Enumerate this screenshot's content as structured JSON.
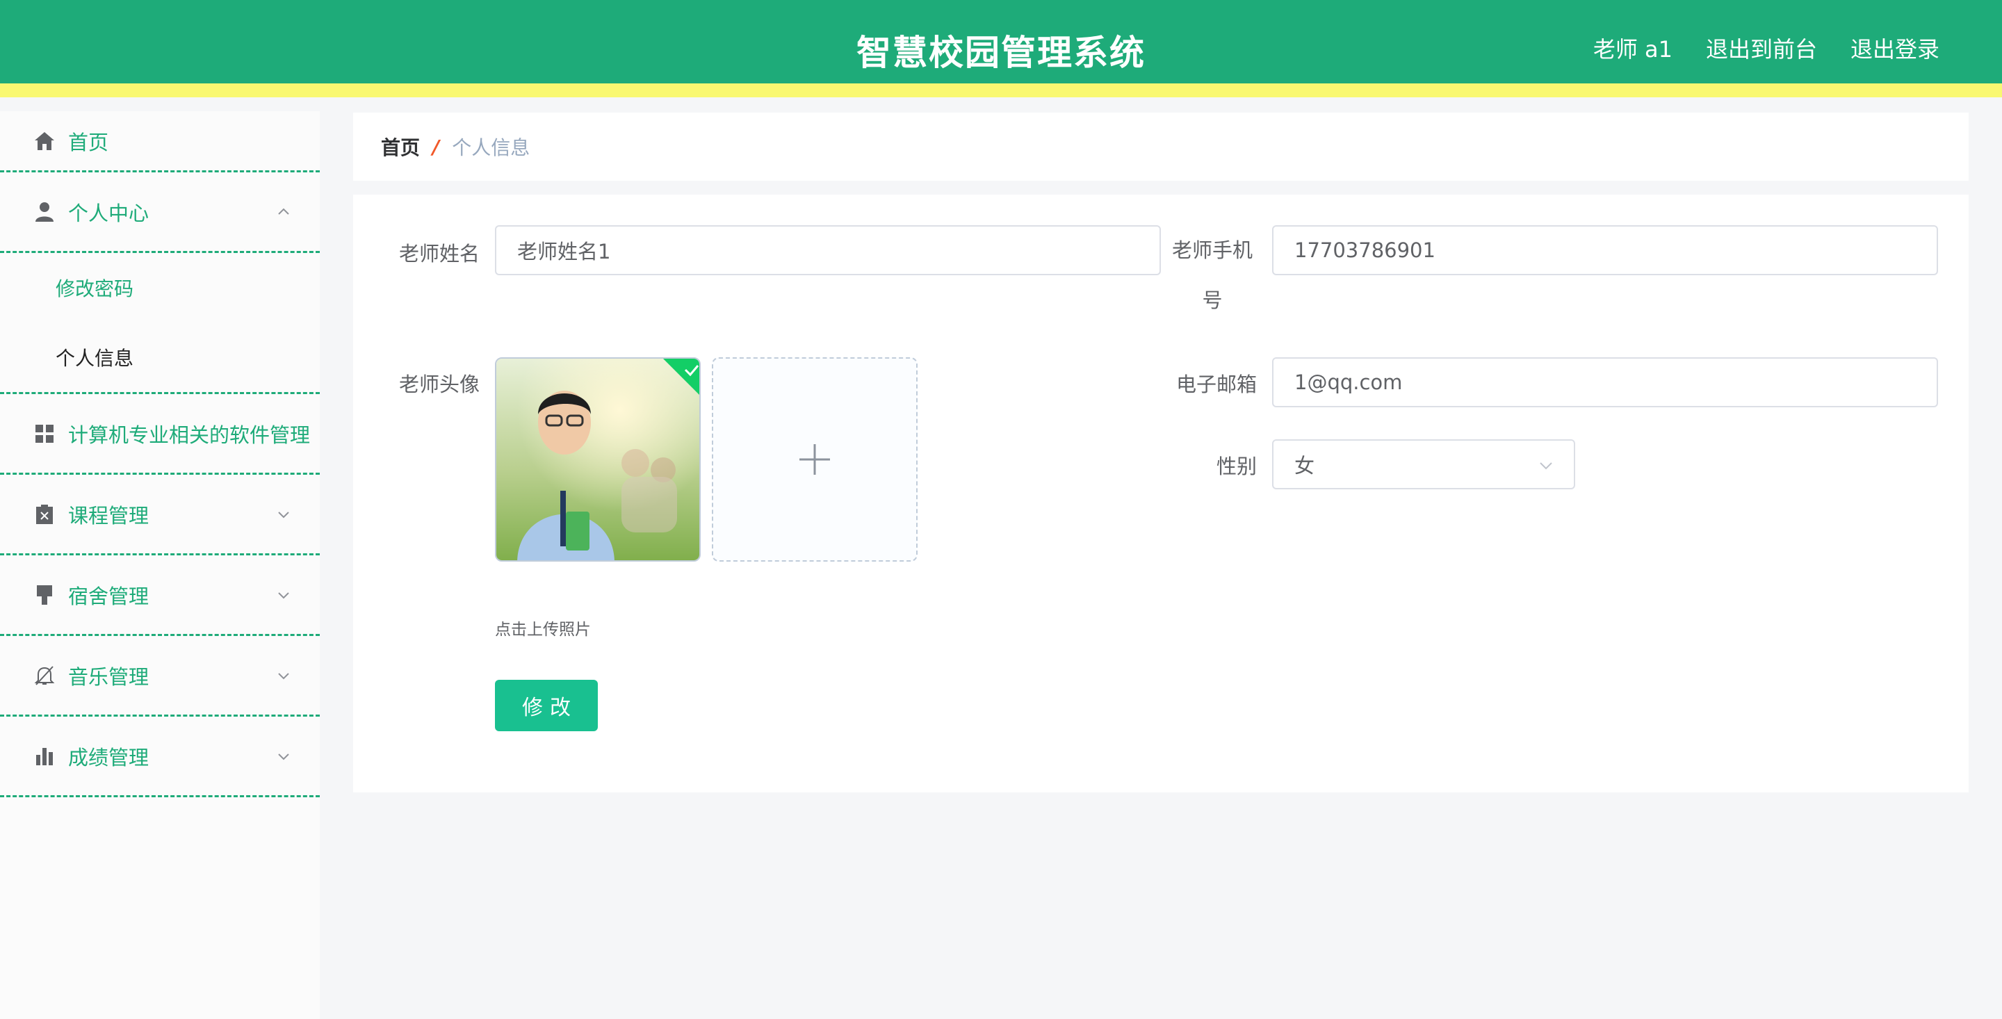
{
  "header": {
    "title": "智慧校园管理系统",
    "user": "老师 a1",
    "front_link": "退出到前台",
    "logout": "退出登录",
    "bg_color": "#1eab79",
    "stripe_color": "#f9f871"
  },
  "sidebar": {
    "home": "首页",
    "personal_center": "个人中心",
    "change_password": "修改密码",
    "personal_info": "个人信息",
    "software_mgmt": "计算机专业相关的软件管理",
    "course_mgmt": "课程管理",
    "dorm_mgmt": "宿舍管理",
    "music_mgmt": "音乐管理",
    "score_mgmt": "成绩管理"
  },
  "breadcrumb": {
    "home": "首页",
    "separator": "/",
    "current": "个人信息"
  },
  "form": {
    "name_label": "老师姓名",
    "name_value": "老师姓名1",
    "phone_label": "老师手机号",
    "phone_value": "17703786901",
    "avatar_label": "老师头像",
    "email_label": "电子邮箱",
    "email_value": "1@qq.com",
    "gender_label": "性别",
    "gender_value": "女",
    "upload_hint": "点击上传照片",
    "submit_label": "修改"
  }
}
